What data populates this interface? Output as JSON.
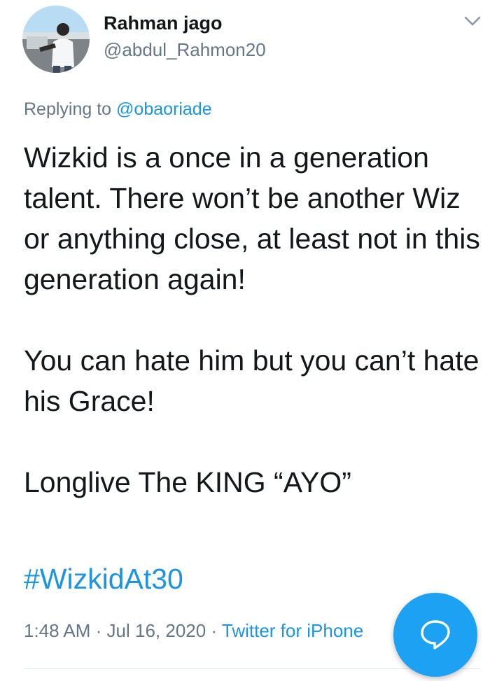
{
  "tweet": {
    "author_name": "Rahman jago",
    "author_handle": "@abdul_Rahmon20",
    "replying_prefix": "Replying to",
    "replying_to": "@obaoriade",
    "paragraphs": [
      "Wizkid is a once in a generation talent.  There won’t be another Wiz or anything close, at least not in this generation again!",
      "You can hate him but you can’t hate his Grace!",
      "Longlive The KING “AYO”"
    ],
    "hashtag": "#WizkidAt30",
    "time": "1:48 AM",
    "separator": "·",
    "date": "Jul 16, 2020",
    "source": "Twitter for iPhone"
  },
  "icons": {
    "menu": "chevron-down-icon",
    "compose": "reply-bubble-icon"
  },
  "colors": {
    "link": "#1b95e0",
    "secondary_text": "#657786",
    "fab": "#1da1f2"
  }
}
